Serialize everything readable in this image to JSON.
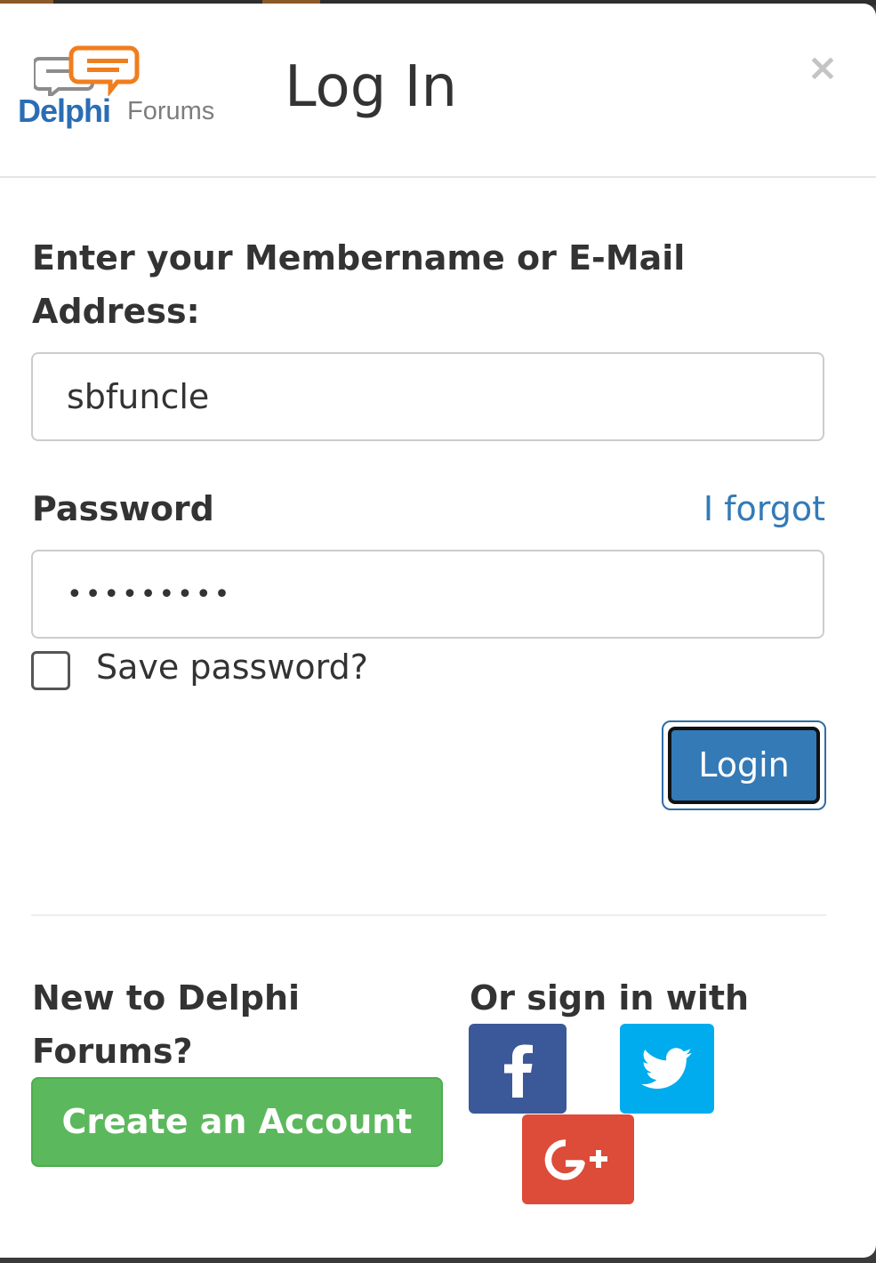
{
  "modal": {
    "title": "Log In",
    "close_label": "×",
    "logo": {
      "word1": "Delphi",
      "word2": "Forums"
    }
  },
  "form": {
    "username_label": "Enter your Membername or E-Mail Address:",
    "username_value": "sbfuncle",
    "password_label": "Password",
    "forgot_link": "I forgot",
    "password_value": "•••••••••",
    "save_password_label": "Save password?",
    "save_password_checked": false,
    "login_button": "Login"
  },
  "signup": {
    "prompt": "New to Delphi Forums?",
    "create_button": "Create an Account"
  },
  "social": {
    "label": "Or sign in with",
    "providers": [
      {
        "name": "facebook",
        "icon": "facebook-icon",
        "color": "#3b5998"
      },
      {
        "name": "twitter",
        "icon": "twitter-icon",
        "color": "#00acee"
      },
      {
        "name": "google-plus",
        "icon": "google-plus-icon",
        "color": "#dd4b39"
      }
    ]
  },
  "colors": {
    "primary": "#337ab7",
    "success": "#5cb85c",
    "link": "#337ab7"
  }
}
